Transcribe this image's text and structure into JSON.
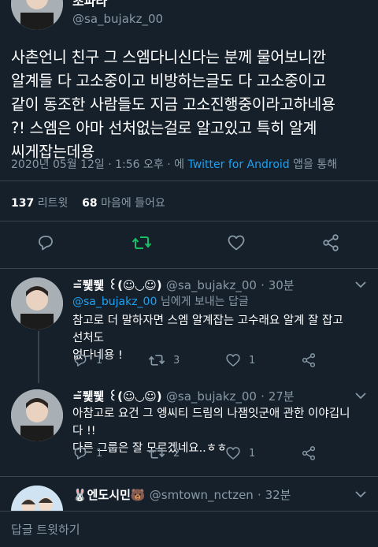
{
  "main_tweet": {
    "display_name": "초파라",
    "handle": "@sa_bujakz_00",
    "text_lines": [
      "사촌언니 친구 그 스엠다니신다는 분께 물어보니깐",
      "알계들 다 고소중이고 비방하는글도 다 고소중이고",
      "같이 동조한 사람들도 지금 고소진행중이라고하네용",
      "?! 스엠은 아마 선처없는걸로 알고있고 특히 알계",
      "씨게잡는데용"
    ],
    "timestamp": "2020년 05월 12일 · 1:56 오후 · 에",
    "source": "Twitter for Android",
    "via_suffix": "앱을 통해",
    "retweets_count": "137",
    "retweets_label": "리트윗",
    "likes_count": "68",
    "likes_label": "마음에 들어요"
  },
  "replies": [
    {
      "display_name": "=̆̈퓇퓇 ꒰(☺︎◡☺︎)",
      "handle": "@sa_bujakz_00",
      "time": "· 30분",
      "replying_to": "@sa_bujakz_00",
      "replying_suffix": "님에게 보내는 답글",
      "text_lines": [
        "참고로 더 말하자면 스엠 알계잡는 고수래요 알계 잘 잡고 선처도",
        "없다네용 !"
      ],
      "reply_count": "1",
      "retweet_count": "3",
      "like_count": "1"
    },
    {
      "display_name": "=̆̈퓇퓇 ꒰(☺︎◡☺︎)",
      "handle": "@sa_bujakz_00",
      "time": "· 27분",
      "text_lines": [
        "아참고로 요건 그 엥씨티 드림의 나잼잇군애 관한 이야깁니다 !!",
        "다른 그룹은 잘 모르겠네요..ㅎㅎ"
      ],
      "reply_count": "1",
      "retweet_count": "2",
      "like_count": "1"
    },
    {
      "display_name": "🐰엔도시민🐻",
      "handle": "@smtown_nctzen",
      "time": "· 32분"
    }
  ],
  "compose": {
    "placeholder": "답글 트윗하기"
  },
  "colors": {
    "background": "#15202b",
    "accent": "#1da1f2",
    "retweet_green": "#17bf63",
    "muted": "#8899a6",
    "divider": "#38444d"
  }
}
